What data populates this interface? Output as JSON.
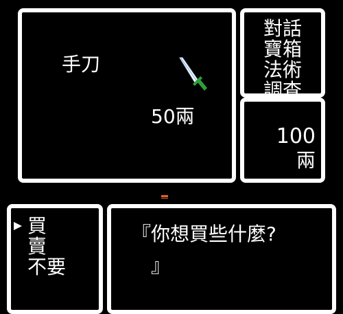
{
  "shop_item": {
    "name": "手刀",
    "price": "50兩",
    "icon": "dagger-icon"
  },
  "commands": [
    "對話",
    "寶箱",
    "法術",
    "調查"
  ],
  "money": {
    "amount": "100",
    "unit": "兩"
  },
  "shop_menu": {
    "options": [
      "買",
      "賣",
      "不要"
    ],
    "selected_index": 0
  },
  "dialog": {
    "line1": "『你想買些什麼?",
    "line2": "』"
  },
  "colors": {
    "background": "#000000",
    "border": "#ffffff",
    "text": "#ffffff",
    "cursor_mark": "#e0642b",
    "blade": "#ffffff",
    "hilt": "#2e9e3a"
  }
}
